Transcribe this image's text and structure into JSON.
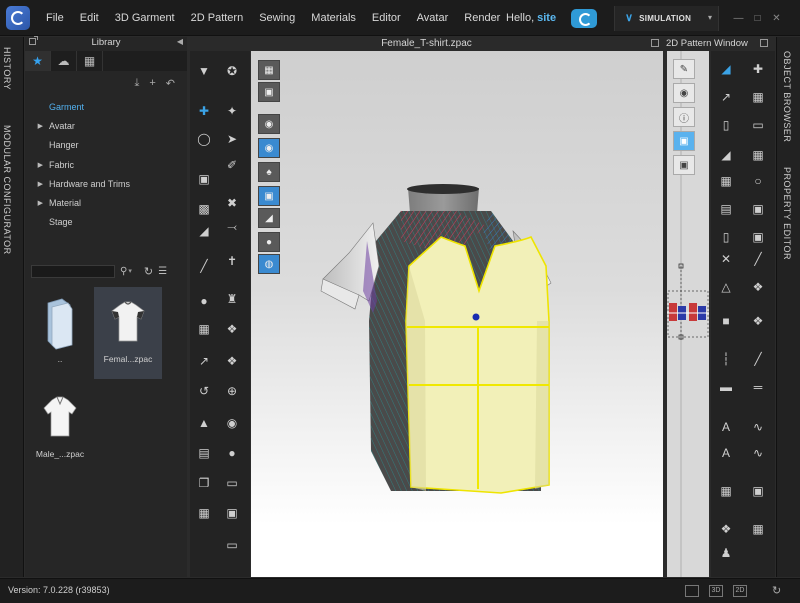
{
  "menubar": {
    "items": [
      "File",
      "Edit",
      "3D Garment",
      "2D Pattern",
      "Sewing",
      "Materials",
      "Editor",
      "Avatar",
      "Render"
    ],
    "greeting": "Hello,",
    "username": "site",
    "mode": "SIMULATION"
  },
  "left_tabs": [
    "HISTORY",
    "MODULAR CONFIGURATOR"
  ],
  "right_tabs": [
    "OBJECT BROWSER",
    "PROPERTY EDITOR"
  ],
  "library": {
    "title": "Library",
    "tree": [
      {
        "label": "Garment",
        "expandable": false,
        "active": true
      },
      {
        "label": "Avatar",
        "expandable": true,
        "active": false
      },
      {
        "label": "Hanger",
        "expandable": false,
        "active": false
      },
      {
        "label": "Fabric",
        "expandable": true,
        "active": false
      },
      {
        "label": "Hardware and Trims",
        "expandable": true,
        "active": false
      },
      {
        "label": "Material",
        "expandable": true,
        "active": false
      },
      {
        "label": "Stage",
        "expandable": false,
        "active": false
      }
    ],
    "search": {
      "value": "",
      "placeholder": ""
    },
    "files": [
      {
        "name": "..",
        "icon": "folder-icon",
        "selected": false
      },
      {
        "name": "Femal...zpac",
        "icon": "tshirt-thumbnail",
        "selected": true
      },
      {
        "name": "Male_...zpac",
        "icon": "vneck-thumbnail",
        "selected": false
      }
    ]
  },
  "view3d": {
    "title": "Female_T-shirt.zpac"
  },
  "view2d": {
    "title": "2D Pattern Window"
  },
  "status": {
    "version": "Version: 7.0.228 (r39853)",
    "view_buttons": [
      "",
      "3D",
      "2D"
    ]
  },
  "colors": {
    "accent": "#3ba3e6",
    "garment_fill": "#f2f0b8",
    "seam_line": "#f0e800",
    "pin_dot": "#1a2db0"
  }
}
